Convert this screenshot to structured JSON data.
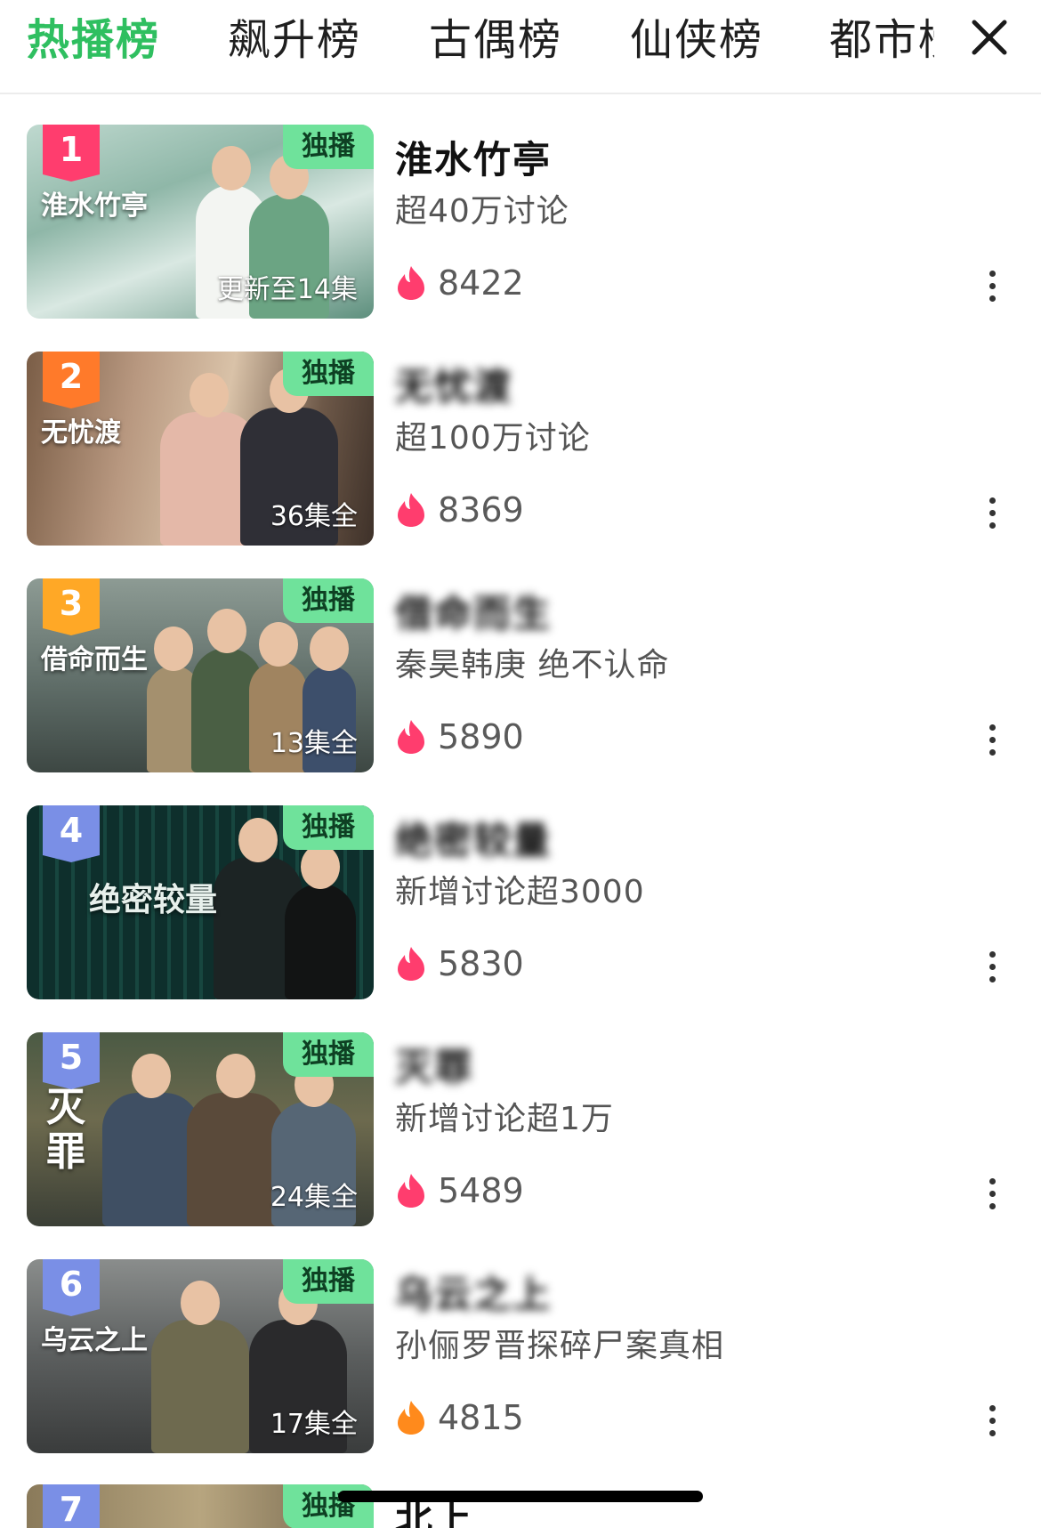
{
  "tabs": [
    {
      "label": "热播榜",
      "active": true
    },
    {
      "label": "飙升榜",
      "active": false
    },
    {
      "label": "古偶榜",
      "active": false
    },
    {
      "label": "仙侠榜",
      "active": false
    },
    {
      "label": "都市榜",
      "active": false
    }
  ],
  "close_icon": "close-icon",
  "exclusive_label": "独播",
  "rank_colors": {
    "1": "#ff3d6e",
    "2": "#ff7a2a",
    "3": "#ffa826",
    "other": "#7a8fe6"
  },
  "heat_colors": {
    "hot": "#ff3d6e",
    "warm": "#ff8a1c"
  },
  "items": [
    {
      "rank": "1",
      "title": "淮水竹亭",
      "title_redacted": false,
      "subtitle": "超40万讨论",
      "heat": "8422",
      "episode_tag": "更新至14集",
      "poster_title": "淮水竹亭",
      "heat_level": "hot"
    },
    {
      "rank": "2",
      "title": "无忧渡",
      "title_redacted": true,
      "subtitle": "超100万讨论",
      "heat": "8369",
      "episode_tag": "36集全",
      "poster_title": "无忧渡",
      "heat_level": "hot"
    },
    {
      "rank": "3",
      "title": "借命而生",
      "title_redacted": true,
      "subtitle": "秦昊韩庚 绝不认命",
      "heat": "5890",
      "episode_tag": "13集全",
      "poster_title": "借命而生",
      "heat_level": "hot"
    },
    {
      "rank": "4",
      "title": "绝密较量",
      "title_redacted": true,
      "subtitle": "新增讨论超3000",
      "heat": "5830",
      "episode_tag": "",
      "poster_title": "绝密较量",
      "heat_level": "hot"
    },
    {
      "rank": "5",
      "title": "灭罪",
      "title_redacted": true,
      "subtitle": "新增讨论超1万",
      "heat": "5489",
      "episode_tag": "24集全",
      "poster_title": "灭罪",
      "heat_level": "hot"
    },
    {
      "rank": "6",
      "title": "乌云之上",
      "title_redacted": true,
      "subtitle": "孙俪罗晋探碎尸案真相",
      "heat": "4815",
      "episode_tag": "17集全",
      "poster_title": "乌云之上",
      "heat_level": "warm"
    },
    {
      "rank": "7",
      "title": "北上",
      "title_redacted": false,
      "subtitle": "",
      "heat": "",
      "episode_tag": "",
      "poster_title": "",
      "heat_level": "hot"
    }
  ]
}
